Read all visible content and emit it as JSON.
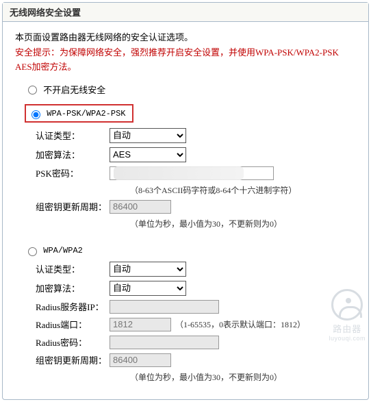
{
  "panel": {
    "title": "无线网络安全设置"
  },
  "intro": {
    "desc": "本页面设置路由器无线网络的安全认证选项。",
    "warning": "安全提示：为保障网络安全，强烈推荐开启安全设置，并使用WPA-PSK/WPA2-PSK AES加密方法。"
  },
  "security_options": {
    "disable": {
      "label": "不开启无线安全",
      "checked": false
    },
    "wpa_psk": {
      "label": "WPA-PSK/WPA2-PSK",
      "checked": true
    },
    "wpa": {
      "label": "WPA/WPA2",
      "checked": false
    }
  },
  "wpa_psk": {
    "auth_label": "认证类型：",
    "auth_value": "自动",
    "encrypt_label": "加密算法：",
    "encrypt_value": "AES",
    "psk_label": "PSK密码：",
    "psk_value": "",
    "psk_hint": "（8-63个ASCII码字符或8-64个十六进制字符）",
    "group_label": "组密钥更新周期：",
    "group_value": "86400",
    "group_hint": "（单位为秒，最小值为30，不更新则为0）"
  },
  "wpa": {
    "auth_label": "认证类型：",
    "auth_value": "自动",
    "encrypt_label": "加密算法：",
    "encrypt_value": "自动",
    "radius_ip_label": "Radius服务器IP：",
    "radius_ip_value": "",
    "radius_port_label": "Radius端口：",
    "radius_port_value": "1812",
    "radius_port_hint": "（1-65535，0表示默认端口：1812）",
    "radius_pwd_label": "Radius密码：",
    "radius_pwd_value": "",
    "group_label": "组密钥更新周期：",
    "group_value": "86400",
    "group_hint": "（单位为秒，最小值为30，不更新则为0）"
  },
  "watermark": {
    "text": "路由器",
    "sub": "luyouqi.com"
  }
}
